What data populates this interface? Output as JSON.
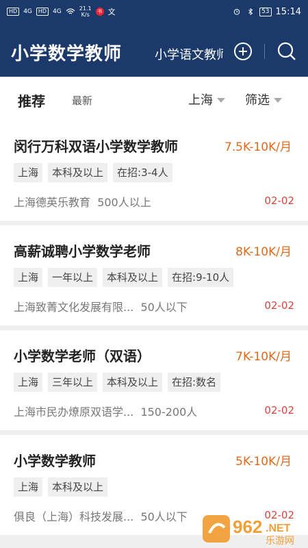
{
  "status_bar": {
    "sim1": "HD",
    "sim2": "HD",
    "net1": "4G",
    "net2": "4G",
    "speed_value": "21.1",
    "speed_unit": "K/s",
    "badge": "书",
    "ime": "文",
    "battery": "53",
    "time": "15:14"
  },
  "header": {
    "title": "小学数学教师",
    "tab2": "小学语文教师",
    "icons": [
      "plus-circle-icon",
      "search-icon"
    ]
  },
  "filters": {
    "tab_recommend": "推荐",
    "tab_latest": "最新",
    "city": "上海",
    "filter": "筛选"
  },
  "jobs": [
    {
      "title": "闵行万科双语小学数学教师",
      "salary": "7.5K-10K/月",
      "tags": [
        "上海",
        "本科及以上",
        "在招:3-4人"
      ],
      "company": "上海德英乐教育",
      "size": "500人以上",
      "date": "02-02"
    },
    {
      "title": "高薪诚聘小学数学老师",
      "salary": "8K-10K/月",
      "tags": [
        "上海",
        "一年以上",
        "本科及以上",
        "在招:9-10人"
      ],
      "company": "上海致菁文化发展有限...",
      "size": "50人以下",
      "date": "02-02"
    },
    {
      "title": "小学数学老师（双语）",
      "salary": "7K-10K/月",
      "tags": [
        "上海",
        "三年以上",
        "本科及以上",
        "在招:数名"
      ],
      "company": "上海市民办燎原双语学...",
      "size": "150-200人",
      "date": "02-02"
    },
    {
      "title": "小学数学教师",
      "salary": "5K-10K/月",
      "tags": [
        "上海",
        "本科及以上"
      ],
      "company": "俱良（上海）科技发展...",
      "size": "50人以下",
      "date": "02-02"
    }
  ],
  "watermark": {
    "brand": "962",
    "domain": ".NET",
    "name": "乐游网"
  },
  "colors": {
    "header_bg": "#1b3a6b",
    "salary": "#e06a1b",
    "date": "#d9433b"
  }
}
